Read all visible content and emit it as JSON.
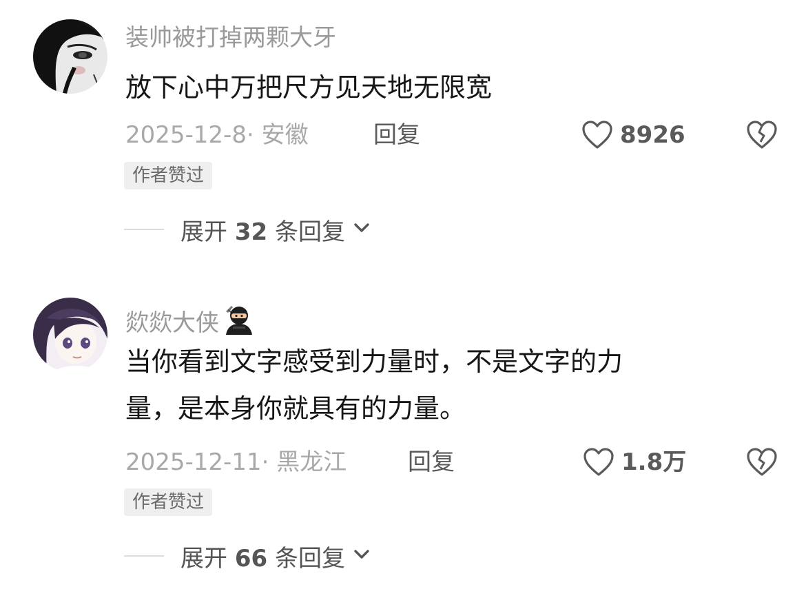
{
  "comments": [
    {
      "username": "装帅被打掉两颗大牙",
      "text": "放下心中万把尺方见天地无限宽",
      "date": "2025-12-8",
      "location": "安徽",
      "date_location": "2025-12-8· 安徽",
      "reply_label": "回复",
      "likes": "8926",
      "badge": "作者赞过",
      "expand": {
        "prefix": "展开",
        "count": "32",
        "suffix": "条回复"
      },
      "avatar_icon": "manga-girl-dark-avatar"
    },
    {
      "username": "欻欻大侠",
      "username_emoji": "ninja-emoji",
      "text_line1": "当你看到文字感受到力量时，不是文字的力",
      "text_line2": "量，是本身你就具有的力量。",
      "date": "2025-12-11",
      "location": "黑龙江",
      "date_location": "2025-12-11· 黑龙江",
      "reply_label": "回复",
      "likes": "1.8万",
      "badge": "作者赞过",
      "expand": {
        "prefix": "展开",
        "count": "66",
        "suffix": "条回复"
      },
      "avatar_icon": "anime-girl-purple-hair-avatar"
    }
  ],
  "icons": {
    "like": "heart-outline-icon",
    "dislike": "broken-heart-icon",
    "expand": "chevron-down-icon"
  },
  "colors": {
    "text_primary": "#161616",
    "text_secondary": "#9a9a9a",
    "badge_bg": "#efefef"
  }
}
